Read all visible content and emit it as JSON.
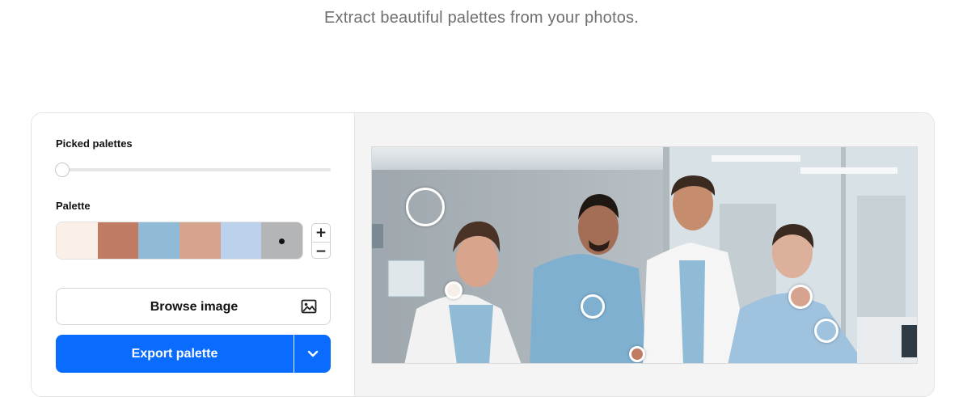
{
  "header": {
    "subtitle": "Extract beautiful palettes from your photos."
  },
  "controls": {
    "picked_palettes_label": "Picked palettes",
    "picked_palettes_value": 0,
    "palette_label": "Palette",
    "palette_colors": [
      "#fbf0e8",
      "#c07c62",
      "#8fbbd6",
      "#d5a38e",
      "#bcd2ec",
      "#b3b5b6"
    ],
    "selected_swatch_index": 5,
    "stepper": {
      "increment": "+",
      "decrement": "−"
    },
    "browse_label": "Browse image",
    "browse_icon": "image-icon",
    "export_label": "Export palette",
    "export_dropdown_icon": "chevron-down-icon",
    "accent": "#0a6cff"
  },
  "image": {
    "description_icon": "photo",
    "pickers": [
      {
        "color": "#b9b9b9"
      },
      {
        "color": "#f6efe9"
      },
      {
        "color": "#8fbbd6"
      },
      {
        "color": "#c07c62"
      },
      {
        "color": "#d5a38e"
      },
      {
        "color": "#bcd2ec"
      }
    ]
  }
}
